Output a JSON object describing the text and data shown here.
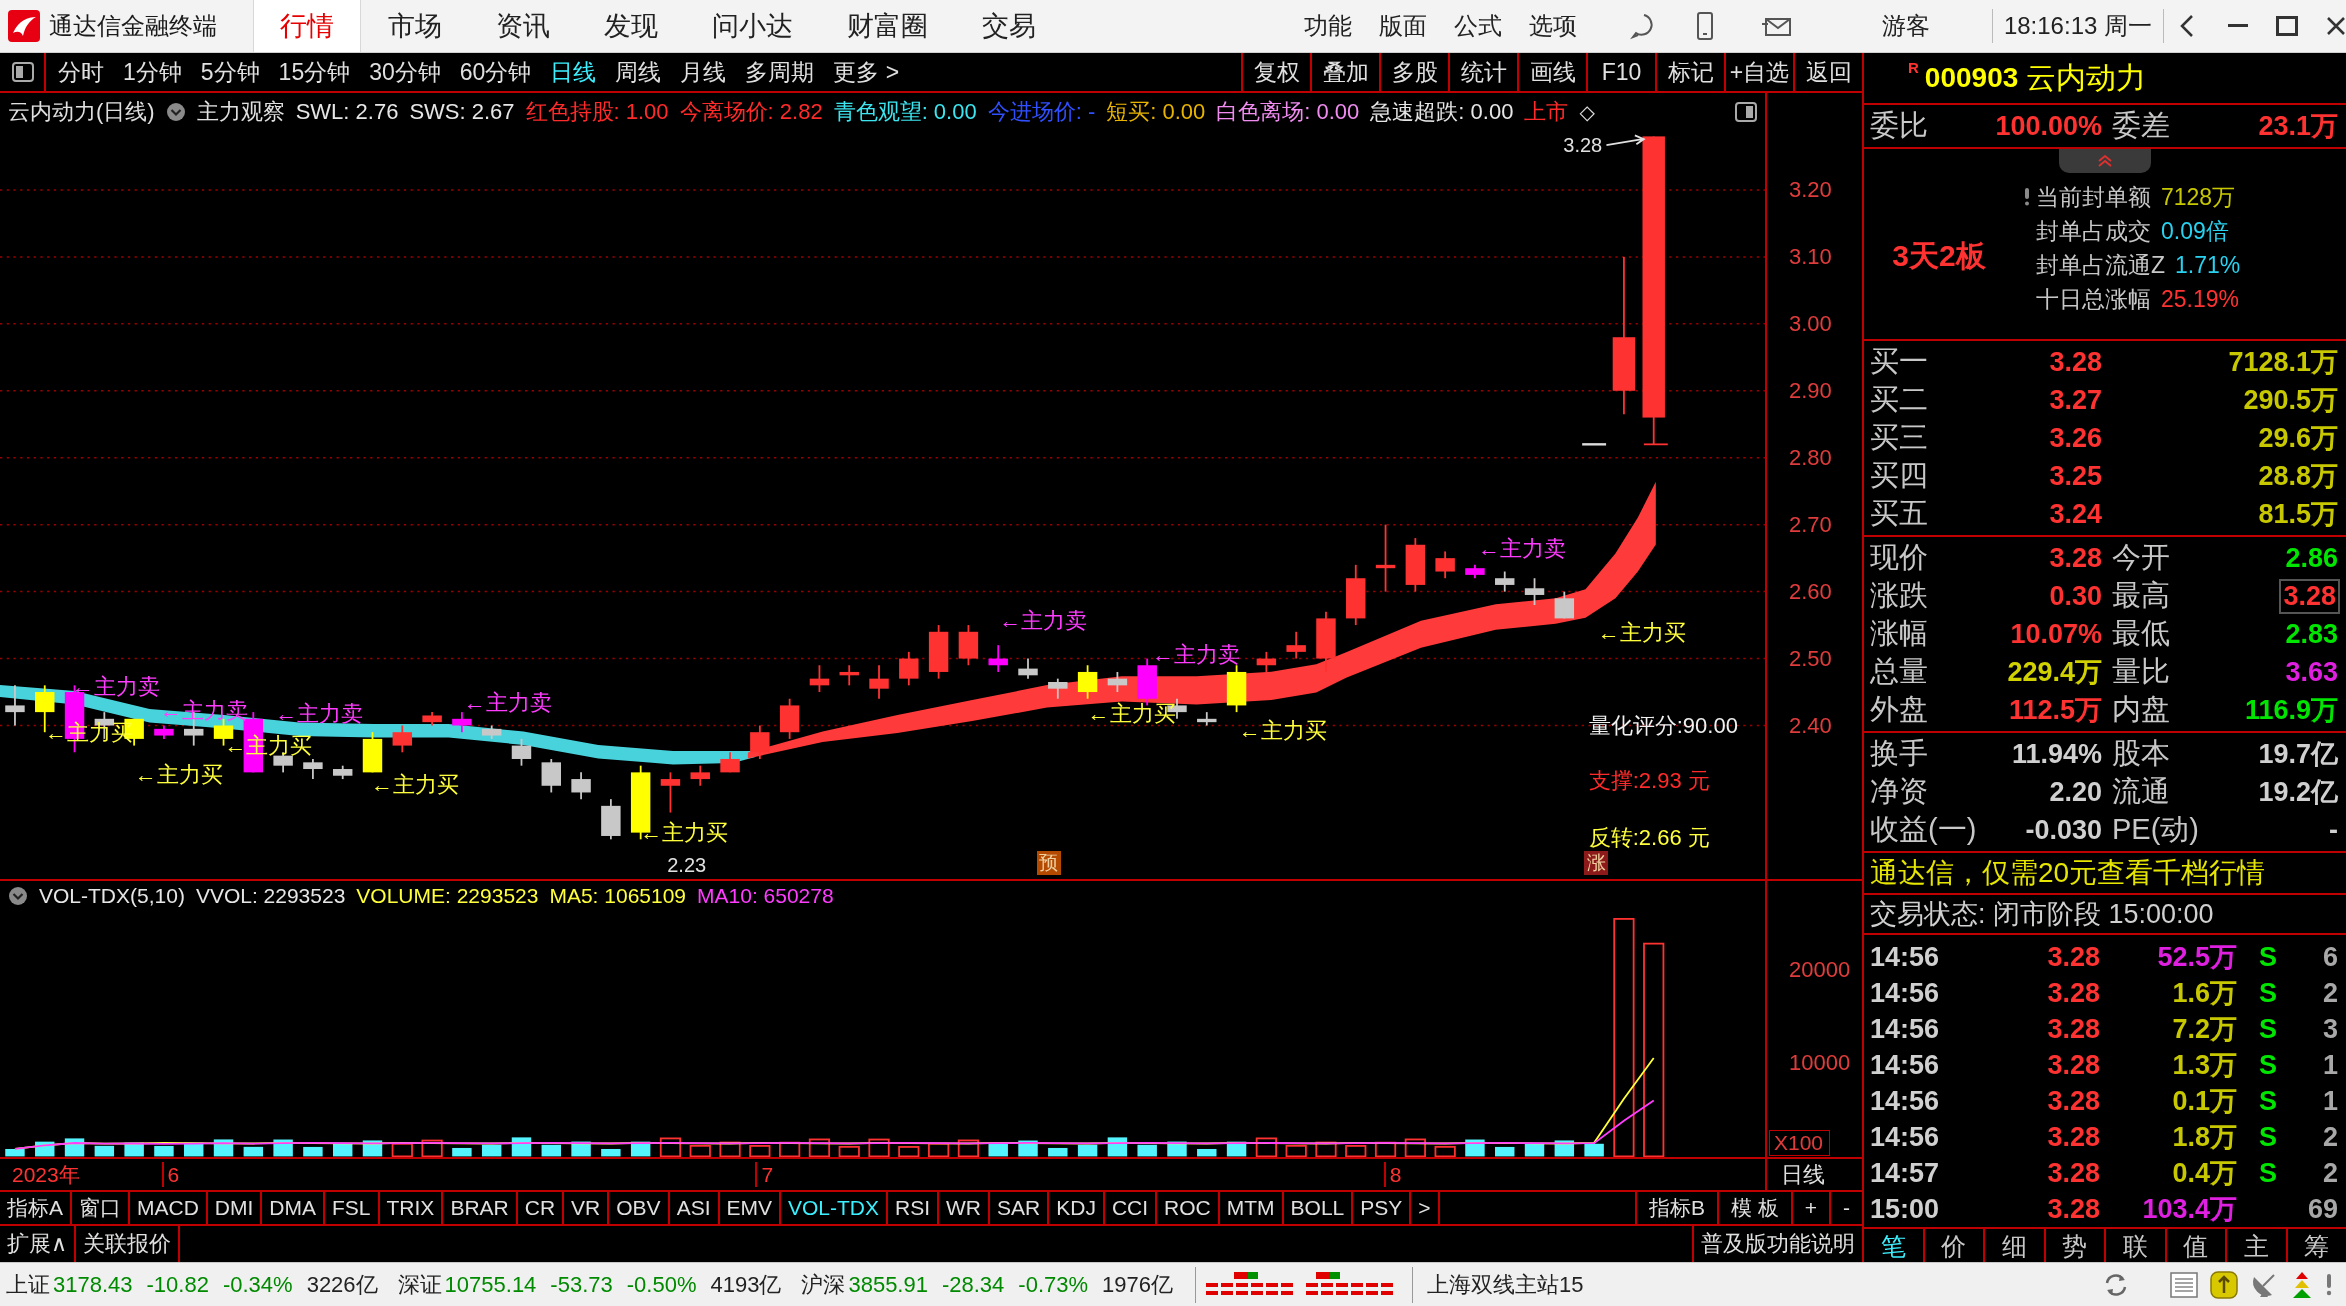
{
  "title_bar": {
    "app_name": "通达信金融终端",
    "tabs": [
      {
        "label": "行情",
        "selected": true
      },
      {
        "label": "市场",
        "selected": false
      },
      {
        "label": "资讯",
        "selected": false
      },
      {
        "label": "发现",
        "selected": false
      },
      {
        "label": "问小达",
        "selected": false
      },
      {
        "label": "财富圈",
        "selected": false
      },
      {
        "label": "交易",
        "selected": false
      }
    ],
    "menu": [
      "功能",
      "版面",
      "公式",
      "选项"
    ],
    "user": "游客",
    "clock": "18:16:13 周一"
  },
  "period_bar": {
    "periods": [
      {
        "label": "分时",
        "selected": false
      },
      {
        "label": "1分钟",
        "selected": false
      },
      {
        "label": "5分钟",
        "selected": false
      },
      {
        "label": "15分钟",
        "selected": false
      },
      {
        "label": "30分钟",
        "selected": false
      },
      {
        "label": "60分钟",
        "selected": false
      },
      {
        "label": "日线",
        "selected": true
      },
      {
        "label": "周线",
        "selected": false
      },
      {
        "label": "月线",
        "selected": false
      },
      {
        "label": "多周期",
        "selected": false
      }
    ],
    "more": "更多 >",
    "actions": [
      "复权",
      "叠加",
      "多股",
      "统计",
      "画线",
      "F10",
      "标记",
      "+自选",
      "返回"
    ]
  },
  "price_chart": {
    "title": "云内动力(日线)",
    "indicator": "主力观察",
    "readouts": [
      {
        "text": "SWL: 2.76",
        "color": "#e6e6e6"
      },
      {
        "text": "SWS: 2.67",
        "color": "#e6e6e6"
      },
      {
        "text": "红色持股: 1.00",
        "color": "#ff2a2a"
      },
      {
        "text": "今离场价: 2.82",
        "color": "#ff2a2a"
      },
      {
        "text": "青色观望: 0.00",
        "color": "#3ce6f0"
      },
      {
        "text": "今进场价: -",
        "color": "#3050ff"
      },
      {
        "text": "短买: 0.00",
        "color": "#e8b400"
      },
      {
        "text": "白色离场: 0.00",
        "color": "#f08cf0"
      },
      {
        "text": "急速超跌: 0.00",
        "color": "#e6e6e6"
      },
      {
        "text": "上市",
        "color": "#ff2a2a"
      }
    ],
    "more": "◇",
    "price_ticks": [
      "3.20",
      "3.10",
      "3.00",
      "2.90",
      "2.80",
      "2.70",
      "2.60",
      "2.50",
      "2.40"
    ],
    "high_label": "3.28",
    "low_label": "2.23",
    "annotations": [
      {
        "text": "←主力买",
        "kind": "buy"
      },
      {
        "text": "←主力卖",
        "kind": "sell"
      },
      {
        "text": "←主力买",
        "kind": "buy"
      },
      {
        "text": "←主力卖",
        "kind": "sell"
      },
      {
        "text": "←主力买",
        "kind": "buy"
      },
      {
        "text": "←主力卖",
        "kind": "sell"
      },
      {
        "text": "←主力买",
        "kind": "buy"
      },
      {
        "text": "←主力卖",
        "kind": "sell"
      },
      {
        "text": "←主力买",
        "kind": "buy"
      },
      {
        "text": "←主力卖",
        "kind": "sell"
      },
      {
        "text": "←主力买",
        "kind": "buy"
      },
      {
        "text": "←主力卖",
        "kind": "sell"
      },
      {
        "text": "←主力买",
        "kind": "buy"
      },
      {
        "text": "←主力卖",
        "kind": "sell"
      },
      {
        "text": "←主力买",
        "kind": "buy"
      }
    ],
    "signals": [
      {
        "text": "量化评分:90.00",
        "color": "#f0f0f0"
      },
      {
        "text": "支撑:2.93 元",
        "color": "#ff2a2a"
      },
      {
        "text": "反转:2.66 元",
        "color": "#ffff3c"
      }
    ],
    "badges": [
      {
        "text": "预",
        "color": "#b34a00"
      },
      {
        "text": "涨",
        "color": "#8c1a1a"
      }
    ]
  },
  "volume_chart": {
    "readouts": [
      {
        "text": "VOL-TDX(5,10)",
        "color": "#e6e6e6"
      },
      {
        "text": "VVOL: 2293523",
        "color": "#e6e6e6"
      },
      {
        "text": "VOLUME: 2293523",
        "color": "#ffff3c"
      },
      {
        "text": "MA5: 1065109",
        "color": "#ffff3c"
      },
      {
        "text": "MA10: 650278",
        "color": "#ff3cff"
      }
    ],
    "ticks": [
      "20000",
      "10000"
    ],
    "unit": "X100"
  },
  "date_axis": {
    "labels": [
      "2023年",
      "6",
      "7",
      "8"
    ],
    "period": "日线"
  },
  "indicator_bar": {
    "left": [
      "指标A",
      "窗口"
    ],
    "tabs": [
      {
        "label": "MACD",
        "selected": false
      },
      {
        "label": "DMI",
        "selected": false
      },
      {
        "label": "DMA",
        "selected": false
      },
      {
        "label": "FSL",
        "selected": false
      },
      {
        "label": "TRIX",
        "selected": false
      },
      {
        "label": "BRAR",
        "selected": false
      },
      {
        "label": "CR",
        "selected": false
      },
      {
        "label": "VR",
        "selected": false
      },
      {
        "label": "OBV",
        "selected": false
      },
      {
        "label": "ASI",
        "selected": false
      },
      {
        "label": "EMV",
        "selected": false
      },
      {
        "label": "VOL-TDX",
        "selected": true
      },
      {
        "label": "RSI",
        "selected": false
      },
      {
        "label": "WR",
        "selected": false
      },
      {
        "label": "SAR",
        "selected": false
      },
      {
        "label": "KDJ",
        "selected": false
      },
      {
        "label": "CCI",
        "selected": false
      },
      {
        "label": "ROC",
        "selected": false
      },
      {
        "label": "MTM",
        "selected": false
      },
      {
        "label": "BOLL",
        "selected": false
      },
      {
        "label": "PSY",
        "selected": false
      }
    ],
    "more": ">",
    "right": [
      "指标B",
      "模 板",
      "+",
      "-"
    ]
  },
  "extension_bar": {
    "buttons": [
      "扩展∧",
      "关联报价"
    ],
    "help": "普及版功能说明"
  },
  "quote_panel": {
    "market_flag": "R",
    "code": "000903",
    "name": "云内动力",
    "order_ratio": {
      "label": "委比",
      "value": "100.00%",
      "diff_label": "委差",
      "diff_value": "23.1万"
    },
    "limit_streak": "3天2板",
    "seal_stats": [
      {
        "label": "当前封单额",
        "value": "7128万",
        "color": "#c8c800"
      },
      {
        "label": "封单占成交",
        "value": "0.09倍",
        "color": "#28d2f0"
      },
      {
        "label": "封单占流通Z",
        "value": "1.71%",
        "color": "#28d2f0"
      },
      {
        "label": "十日总涨幅",
        "value": "25.19%",
        "color": "#ff3232"
      }
    ],
    "bids": [
      {
        "label": "买一",
        "price": "3.28",
        "volume": "7128.1万"
      },
      {
        "label": "买二",
        "price": "3.27",
        "volume": "290.5万"
      },
      {
        "label": "买三",
        "price": "3.26",
        "volume": "29.6万"
      },
      {
        "label": "买四",
        "price": "3.25",
        "volume": "28.8万"
      },
      {
        "label": "买五",
        "price": "3.24",
        "volume": "81.5万"
      }
    ],
    "quote_rows": [
      {
        "cells": [
          {
            "label": "现价",
            "value": "3.28",
            "color": "#ff3232",
            "outlined": false
          },
          {
            "label": "今开",
            "value": "2.86",
            "color": "#00e600",
            "outlined": false
          }
        ]
      },
      {
        "cells": [
          {
            "label": "涨跌",
            "value": "0.30",
            "color": "#ff3232",
            "outlined": false
          },
          {
            "label": "最高",
            "value": "3.28",
            "color": "#ff3232",
            "outlined": true
          }
        ]
      },
      {
        "cells": [
          {
            "label": "涨幅",
            "value": "10.07%",
            "color": "#ff3232",
            "outlined": false
          },
          {
            "label": "最低",
            "value": "2.83",
            "color": "#00e600",
            "outlined": false
          }
        ]
      },
      {
        "cells": [
          {
            "label": "总量",
            "value": "229.4万",
            "color": "#d2d200",
            "outlined": false
          },
          {
            "label": "量比",
            "value": "3.63",
            "color": "#e020e0",
            "outlined": false
          }
        ]
      },
      {
        "cells": [
          {
            "label": "外盘",
            "value": "112.5万",
            "color": "#ff3232",
            "outlined": false
          },
          {
            "label": "内盘",
            "value": "116.9万",
            "color": "#00e600",
            "outlined": false
          }
        ]
      }
    ],
    "fundamentals": [
      {
        "cells": [
          {
            "label": "换手",
            "value": "11.94%"
          },
          {
            "label": "股本",
            "value": "19.7亿"
          }
        ]
      },
      {
        "cells": [
          {
            "label": "净资",
            "value": "2.20"
          },
          {
            "label": "流通",
            "value": "19.2亿"
          }
        ]
      },
      {
        "cells": [
          {
            "label": "收益(一)",
            "value": "-0.030"
          },
          {
            "label": "PE(动)",
            "value": "-"
          }
        ]
      }
    ],
    "promo": "通达信，仅需20元查看千档行情",
    "trade_status": "交易状态: 闭市阶段 15:00:00",
    "ticks": [
      {
        "time": "14:56",
        "price": "3.28",
        "volume": "52.5万",
        "highlighted": true,
        "side": "S",
        "count": "6"
      },
      {
        "time": "14:56",
        "price": "3.28",
        "volume": "1.6万",
        "highlighted": false,
        "side": "S",
        "count": "2"
      },
      {
        "time": "14:56",
        "price": "3.28",
        "volume": "7.2万",
        "highlighted": false,
        "side": "S",
        "count": "3"
      },
      {
        "time": "14:56",
        "price": "3.28",
        "volume": "1.3万",
        "highlighted": false,
        "side": "S",
        "count": "1"
      },
      {
        "time": "14:56",
        "price": "3.28",
        "volume": "0.1万",
        "highlighted": false,
        "side": "S",
        "count": "1"
      },
      {
        "time": "14:56",
        "price": "3.28",
        "volume": "1.8万",
        "highlighted": false,
        "side": "S",
        "count": "2"
      },
      {
        "time": "14:57",
        "price": "3.28",
        "volume": "0.4万",
        "highlighted": false,
        "side": "S",
        "count": "2"
      },
      {
        "time": "15:00",
        "price": "3.28",
        "volume": "103.4万",
        "highlighted": true,
        "count": "69"
      }
    ],
    "tabs": [
      {
        "label": "笔",
        "selected": true
      },
      {
        "label": "价",
        "selected": false
      },
      {
        "label": "细",
        "selected": false
      },
      {
        "label": "势",
        "selected": false
      },
      {
        "label": "联",
        "selected": false
      },
      {
        "label": "值",
        "selected": false
      },
      {
        "label": "主",
        "selected": false
      },
      {
        "label": "筹",
        "selected": false
      }
    ]
  },
  "status_bar": {
    "indices": [
      {
        "name": "上证",
        "value": "3178.43",
        "change": "-10.82",
        "percent": "-0.34%",
        "amount": "3226亿",
        "falling": true
      },
      {
        "name": "深证",
        "value": "10755.14",
        "change": "-53.73",
        "percent": "-0.50%",
        "amount": "4193亿",
        "falling": true
      },
      {
        "name": "沪深",
        "value": "3855.91",
        "change": "-28.34",
        "percent": "-0.73%",
        "amount": "1976亿",
        "falling": true
      }
    ],
    "server": "上海双线主站15"
  }
}
